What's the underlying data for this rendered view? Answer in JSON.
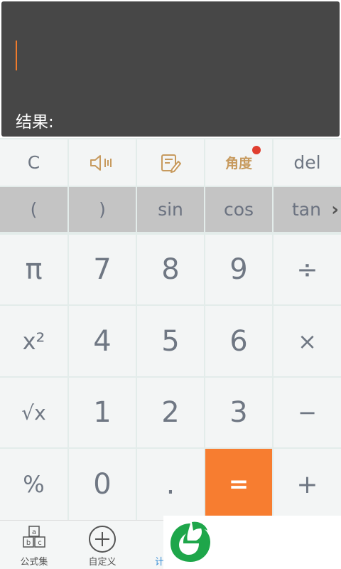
{
  "display": {
    "result_label": "结果:"
  },
  "row0": {
    "clear": "C",
    "angle": "角度",
    "del": "del"
  },
  "row1": {
    "lparen": "(",
    "rparen": ")",
    "sin": "sin",
    "cos": "cos",
    "tan": "tan",
    "more": "›"
  },
  "keys": {
    "pi": "π",
    "seven": "7",
    "eight": "8",
    "nine": "9",
    "divide": "÷",
    "square": "x²",
    "four": "4",
    "five": "5",
    "six": "6",
    "multiply": "×",
    "sqrt": "√x",
    "one": "1",
    "two": "2",
    "three": "3",
    "minus": "−",
    "percent": "%",
    "zero": "0",
    "dot": ".",
    "equals": "=",
    "plus": "+"
  },
  "tabs": {
    "formula": "公式集",
    "custom": "自定义",
    "calc": "计"
  },
  "colors": {
    "accent": "#f77d30",
    "display_bg": "#474747",
    "badge": "#e03e2f"
  }
}
